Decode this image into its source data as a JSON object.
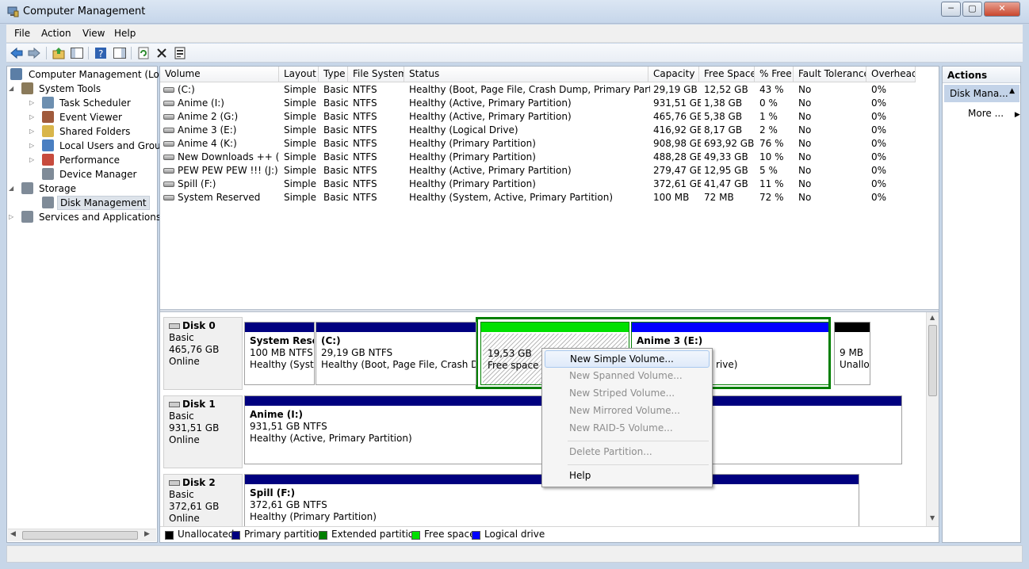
{
  "window": {
    "title": "Computer Management",
    "buttons": {
      "minimize": "─",
      "maximize": "▢",
      "close": "✕"
    }
  },
  "menu": [
    "File",
    "Action",
    "View",
    "Help"
  ],
  "toolbar_icons": [
    "back-arrow-icon",
    "forward-arrow-icon",
    "up-folder-icon",
    "show-hide-tree-icon",
    "help-icon",
    "show-hide-action-pane-icon",
    "refresh-icon",
    "delete-icon",
    "properties-icon"
  ],
  "tree": [
    {
      "label": "Computer Management (Local",
      "indent": 0,
      "arrow": "",
      "icon": "computer-icon",
      "color": "#5b7ea6"
    },
    {
      "label": "System Tools",
      "indent": 1,
      "arrow": "◢",
      "icon": "tools-icon",
      "color": "#8a7a5a"
    },
    {
      "label": "Task Scheduler",
      "indent": 2,
      "arrow": "▷",
      "icon": "clock-icon",
      "color": "#6d8fb0"
    },
    {
      "label": "Event Viewer",
      "indent": 2,
      "arrow": "▷",
      "icon": "event-viewer-icon",
      "color": "#a05a3c"
    },
    {
      "label": "Shared Folders",
      "indent": 2,
      "arrow": "▷",
      "icon": "shared-folder-icon",
      "color": "#d9b64b"
    },
    {
      "label": "Local Users and Groups",
      "indent": 2,
      "arrow": "▷",
      "icon": "users-icon",
      "color": "#4a7fc1"
    },
    {
      "label": "Performance",
      "indent": 2,
      "arrow": "▷",
      "icon": "performance-icon",
      "color": "#c74b3d"
    },
    {
      "label": "Device Manager",
      "indent": 2,
      "arrow": "",
      "icon": "device-manager-icon",
      "color": "#7f8b98"
    },
    {
      "label": "Storage",
      "indent": 1,
      "arrow": "◢",
      "icon": "storage-icon",
      "color": "#7f8b98"
    },
    {
      "label": "Disk Management",
      "indent": 2,
      "arrow": "",
      "icon": "disk-management-icon",
      "color": "#7f8b98",
      "selected": true
    },
    {
      "label": "Services and Applications",
      "indent": 1,
      "arrow": "▷",
      "icon": "services-icon",
      "color": "#7f8b98"
    }
  ],
  "table": {
    "columns": [
      "Volume",
      "Layout",
      "Type",
      "File System",
      "Status",
      "Capacity",
      "Free Space",
      "% Free",
      "Fault Tolerance",
      "Overhead"
    ],
    "rows": [
      [
        "(C:)",
        "Simple",
        "Basic",
        "NTFS",
        "Healthy (Boot, Page File, Crash Dump, Primary Partition)",
        "29,19 GB",
        "12,52 GB",
        "43 %",
        "No",
        "0%"
      ],
      [
        "Anime (I:)",
        "Simple",
        "Basic",
        "NTFS",
        "Healthy (Active, Primary Partition)",
        "931,51 GB",
        "1,38 GB",
        "0 %",
        "No",
        "0%"
      ],
      [
        "Anime 2 (G:)",
        "Simple",
        "Basic",
        "NTFS",
        "Healthy (Active, Primary Partition)",
        "465,76 GB",
        "5,38 GB",
        "1 %",
        "No",
        "0%"
      ],
      [
        "Anime 3 (E:)",
        "Simple",
        "Basic",
        "NTFS",
        "Healthy (Logical Drive)",
        "416,92 GB",
        "8,17 GB",
        "2 %",
        "No",
        "0%"
      ],
      [
        "Anime 4 (K:)",
        "Simple",
        "Basic",
        "NTFS",
        "Healthy (Primary Partition)",
        "908,98 GB",
        "693,92 GB",
        "76 %",
        "No",
        "0%"
      ],
      [
        "New Downloads ++ (S:)",
        "Simple",
        "Basic",
        "NTFS",
        "Healthy (Primary Partition)",
        "488,28 GB",
        "49,33 GB",
        "10 %",
        "No",
        "0%"
      ],
      [
        "PEW PEW PEW !!! (J:)",
        "Simple",
        "Basic",
        "NTFS",
        "Healthy (Active, Primary Partition)",
        "279,47 GB",
        "12,95 GB",
        "5 %",
        "No",
        "0%"
      ],
      [
        "Spill (F:)",
        "Simple",
        "Basic",
        "NTFS",
        "Healthy (Primary Partition)",
        "372,61 GB",
        "41,47 GB",
        "11 %",
        "No",
        "0%"
      ],
      [
        "System Reserved",
        "Simple",
        "Basic",
        "NTFS",
        "Healthy (System, Active, Primary Partition)",
        "100 MB",
        "72 MB",
        "72 %",
        "No",
        "0%"
      ]
    ]
  },
  "disks": [
    {
      "name": "Disk 0",
      "type": "Basic",
      "size": "465,76 GB",
      "status": "Online",
      "partitions": [
        {
          "title": "System Reser",
          "line1": "100 MB NTFS",
          "line2": "Healthy (Syste",
          "bar": "#00007f"
        },
        {
          "title": "(C:)",
          "line1": "29,19 GB NTFS",
          "line2": "Healthy (Boot, Page File, Crash Dum",
          "bar": "#00007f"
        },
        {
          "title": "",
          "line1": "19,53 GB",
          "line2": "Free space",
          "bar": "#00e000"
        },
        {
          "title": "Anime 3  (E:)",
          "line1": "",
          "line2": "rive)",
          "bar": "#0000ff"
        },
        {
          "title": "",
          "line1": "9 MB",
          "line2": "Unallo",
          "bar": "#000000"
        }
      ]
    },
    {
      "name": "Disk 1",
      "type": "Basic",
      "size": "931,51 GB",
      "status": "Online",
      "partitions": [
        {
          "title": "Anime  (I:)",
          "line1": "931,51 GB NTFS",
          "line2": "Healthy (Active, Primary Partition)",
          "bar": "#00007f"
        }
      ]
    },
    {
      "name": "Disk 2",
      "type": "Basic",
      "size": "372,61 GB",
      "status": "Online",
      "partitions": [
        {
          "title": "Spill  (F:)",
          "line1": "372,61 GB NTFS",
          "line2": "Healthy (Primary Partition)",
          "bar": "#00007f"
        }
      ]
    }
  ],
  "legend": [
    {
      "label": "Unallocated",
      "color": "#000000"
    },
    {
      "label": "Primary partition",
      "color": "#00007f"
    },
    {
      "label": "Extended partition",
      "color": "#007f00"
    },
    {
      "label": "Free space",
      "color": "#00e000"
    },
    {
      "label": "Logical drive",
      "color": "#0000ff"
    }
  ],
  "actions": {
    "title": "Actions",
    "selected": "Disk Mana...",
    "more": "More ..."
  },
  "context_menu": {
    "items": [
      {
        "label": "New Simple Volume...",
        "disabled": false,
        "highlighted": true
      },
      {
        "label": "New Spanned Volume...",
        "disabled": true
      },
      {
        "label": "New Striped Volume...",
        "disabled": true
      },
      {
        "label": "New Mirrored Volume...",
        "disabled": true
      },
      {
        "label": "New RAID-5 Volume...",
        "disabled": true
      },
      {
        "label": "Delete Partition...",
        "disabled": true
      },
      {
        "label": "Help",
        "disabled": false
      }
    ]
  }
}
